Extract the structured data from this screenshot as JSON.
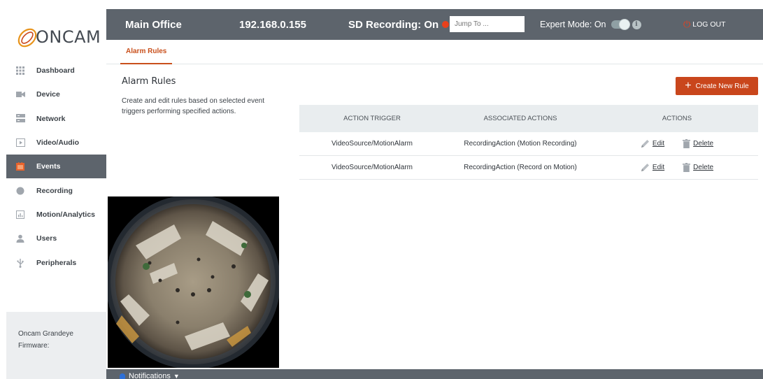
{
  "brand": {
    "logo_text": "ONCAM",
    "accent_color": "#c9461c",
    "header_color": "#5d646c"
  },
  "header": {
    "site_name": "Main Office",
    "ip_address": "192.168.0.155",
    "sd_recording": "SD Recording: On",
    "jump_placeholder": "Jump To ...",
    "expert_mode": "Expert Mode: On",
    "expert_mode_enabled": true,
    "logout_label": "LOG OUT"
  },
  "sidebar": {
    "items": [
      {
        "label": "Dashboard",
        "icon": "grid-icon",
        "active": false
      },
      {
        "label": "Device",
        "icon": "camera-icon",
        "active": false
      },
      {
        "label": "Network",
        "icon": "network-icon",
        "active": false
      },
      {
        "label": "Video/Audio",
        "icon": "play-icon",
        "active": false
      },
      {
        "label": "Events",
        "icon": "calendar-icon",
        "active": true
      },
      {
        "label": "Recording",
        "icon": "record-icon",
        "active": false
      },
      {
        "label": "Motion/Analytics",
        "icon": "analytics-icon",
        "active": false
      },
      {
        "label": "Users",
        "icon": "user-icon",
        "active": false
      },
      {
        "label": "Peripherals",
        "icon": "usb-icon",
        "active": false
      }
    ],
    "footer": {
      "device_name": "Oncam Grandeye",
      "firmware_label": "Firmware:"
    }
  },
  "tabs": [
    {
      "label": "Alarm Rules",
      "active": true
    }
  ],
  "main": {
    "title": "Alarm Rules",
    "description": "Create and edit rules based on selected event triggers performing specified actions.",
    "create_button": "Create New Rule"
  },
  "table": {
    "headers": [
      "ACTION TRIGGER",
      "ASSOCIATED ACTIONS",
      "ACTIONS"
    ],
    "rows": [
      {
        "trigger": "VideoSource/MotionAlarm",
        "action": "RecordingAction (Motion Recording)",
        "edit": "Edit",
        "delete": "Delete"
      },
      {
        "trigger": "VideoSource/MotionAlarm",
        "action": "RecordingAction (Record on Motion)",
        "edit": "Edit",
        "delete": "Delete"
      }
    ]
  },
  "notifications": {
    "label": "Notifications"
  }
}
